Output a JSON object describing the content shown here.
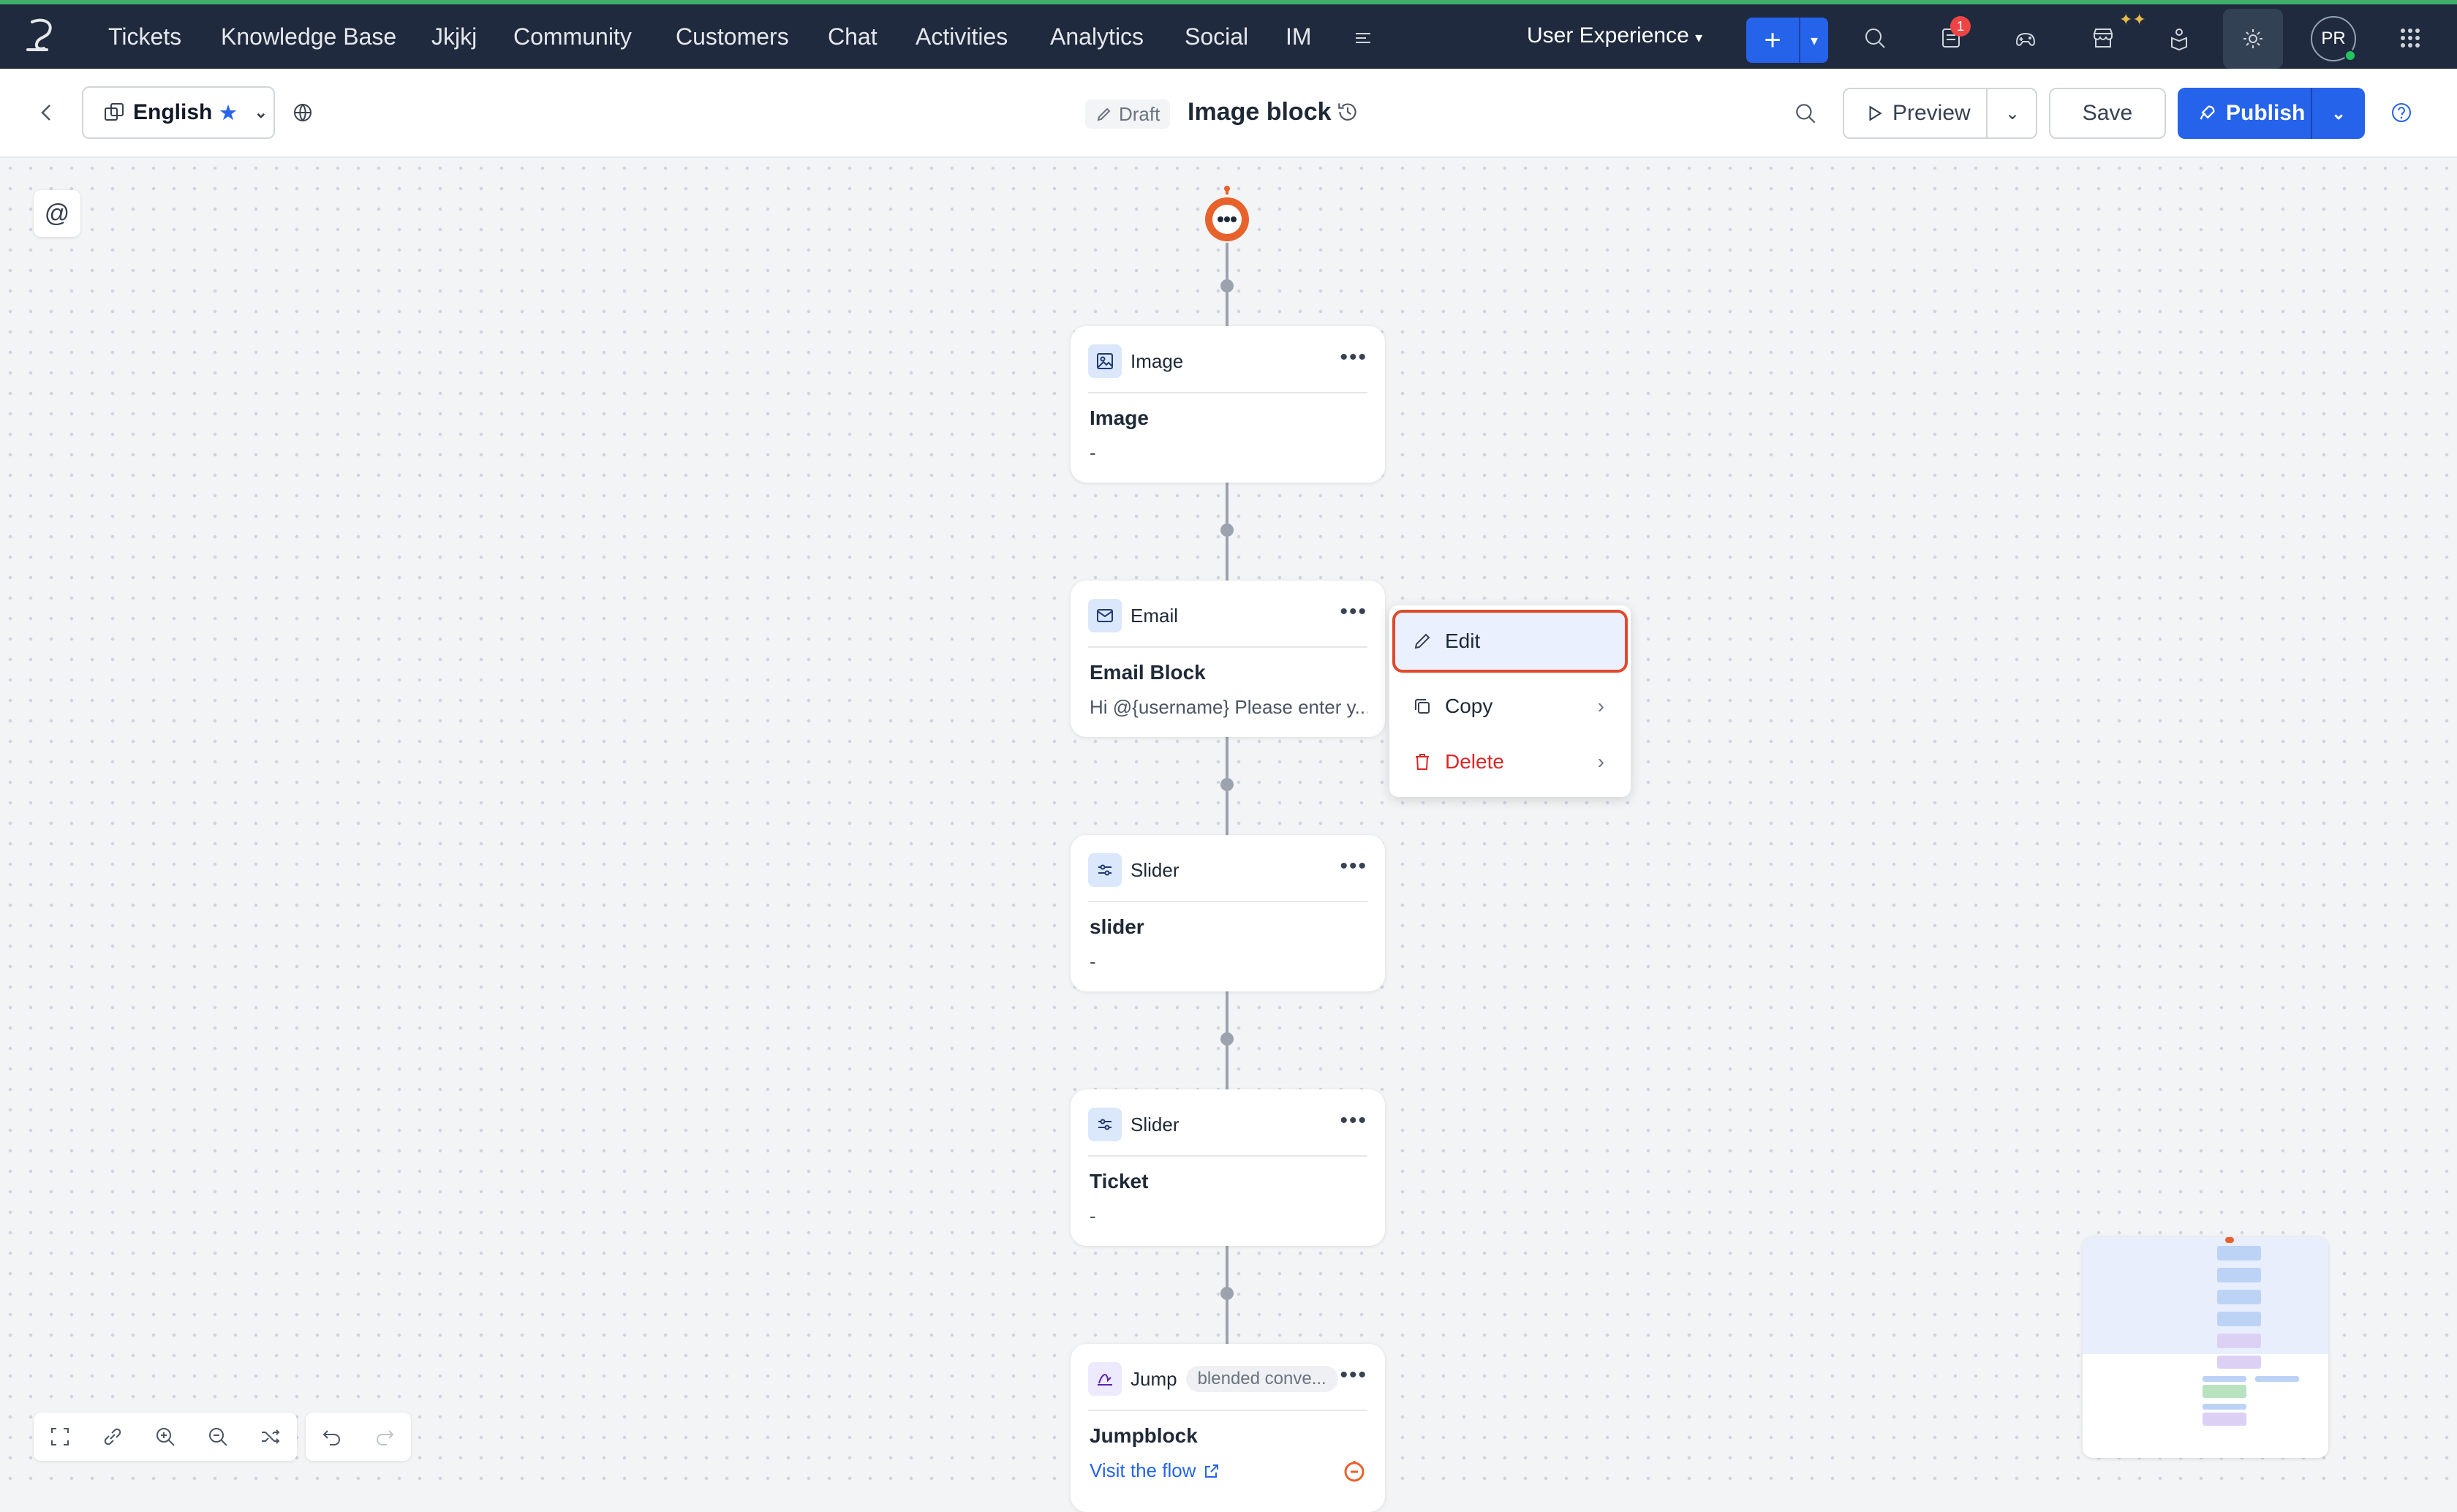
{
  "nav": {
    "items": [
      "Tickets",
      "Knowledge Base",
      "Jkjkj",
      "Community",
      "Customers",
      "Chat",
      "Activities",
      "Analytics",
      "Social",
      "IM"
    ],
    "department": "User Experience",
    "notification_count": "1",
    "avatar_initials": "PR"
  },
  "toolbar": {
    "language": "English",
    "status": "Draft",
    "title": "Image block",
    "preview_label": "Preview",
    "save_label": "Save",
    "publish_label": "Publish"
  },
  "canvas": {
    "mention_symbol": "@",
    "blocks": [
      {
        "type_label": "Image",
        "title": "Image",
        "subtitle": "-"
      },
      {
        "type_label": "Email",
        "title": "Email Block",
        "subtitle": "Hi  @{username} Please enter y..."
      },
      {
        "type_label": "Slider",
        "title": "slider",
        "subtitle": "-"
      },
      {
        "type_label": "Slider",
        "title": "Ticket",
        "subtitle": "-"
      },
      {
        "type_label": "Jump",
        "chip": "blended conve...",
        "title": "Jumpblock",
        "link": "Visit the flow"
      }
    ]
  },
  "context_menu": {
    "edit": "Edit",
    "copy": "Copy",
    "delete": "Delete"
  },
  "colors": {
    "nav_bg": "#1f2a3e",
    "accent": "#2563eb",
    "bot_orange": "#e8622c",
    "danger": "#dc2626"
  }
}
